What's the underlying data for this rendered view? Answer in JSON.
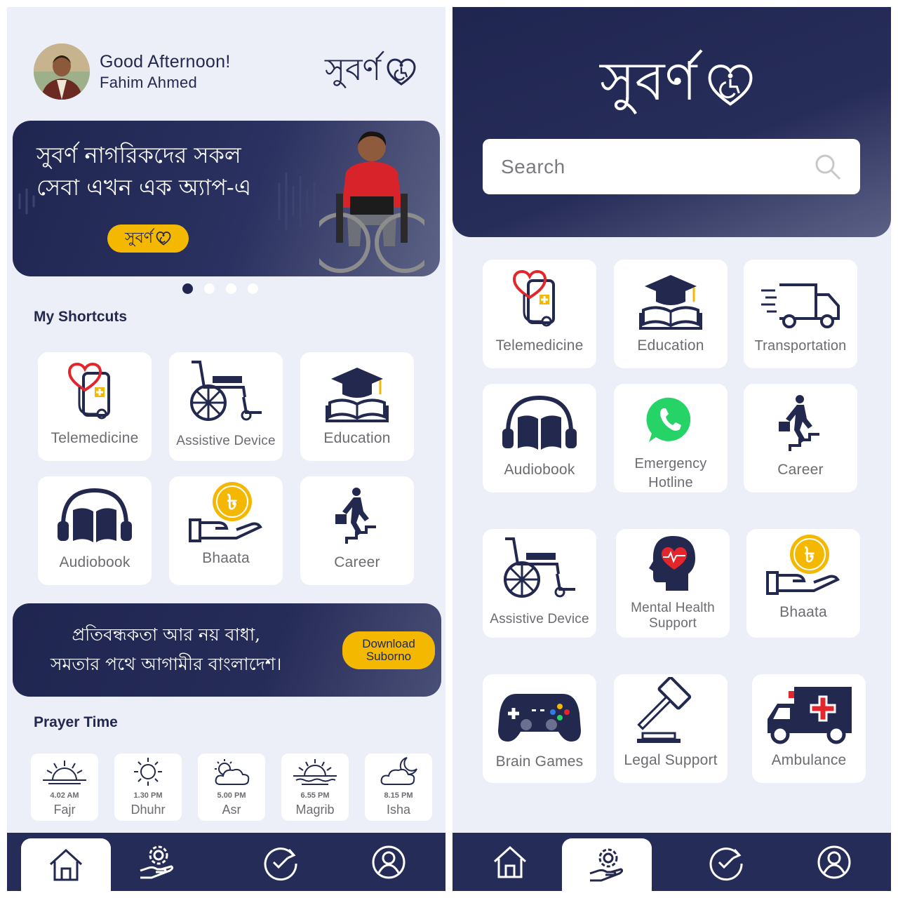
{
  "left": {
    "greeting": "Good Afternoon!",
    "user_name": "Fahim Ahmed",
    "logo_text": "সুবর্ণ",
    "banner": {
      "line1": "সুবর্ণ নাগরিকদের সকল",
      "line2": "সেবা এখন এক অ্যাপ-এ",
      "pill_text": "সুবর্ণ"
    },
    "carousel": {
      "count": 4,
      "active": 0
    },
    "shortcuts_title": "My Shortcuts",
    "shortcuts": [
      {
        "label": "Telemedicine",
        "icon": "telemedicine-icon"
      },
      {
        "label": "Assistive Device",
        "icon": "wheelchair-icon"
      },
      {
        "label": "Education",
        "icon": "education-icon"
      },
      {
        "label": "Audiobook",
        "icon": "audiobook-icon"
      },
      {
        "label": "Bhaata",
        "icon": "bhaata-icon"
      },
      {
        "label": "Career",
        "icon": "career-icon"
      }
    ],
    "promo": {
      "line1": "প্রতিবন্ধকতা আর নয় বাধা,",
      "line2": "সমতার পথে আগামীর বাংলাদেশ।",
      "button_line1": "Download",
      "button_line2": "Suborno"
    },
    "prayer_title": "Prayer Time",
    "prayers": [
      {
        "time": "4.02 AM",
        "name": "Fajr",
        "icon": "sunrise-icon"
      },
      {
        "time": "1.30 PM",
        "name": "Dhuhr",
        "icon": "sun-icon"
      },
      {
        "time": "5.00 PM",
        "name": "Asr",
        "icon": "sun-cloud-icon"
      },
      {
        "time": "6.55 PM",
        "name": "Magrib",
        "icon": "sunset-icon"
      },
      {
        "time": "8.15 PM",
        "name": "Isha",
        "icon": "moon-cloud-icon"
      }
    ],
    "nav": [
      {
        "icon": "home-icon",
        "active": true
      },
      {
        "icon": "services-icon",
        "active": false
      },
      {
        "icon": "history-icon",
        "active": false
      },
      {
        "icon": "profile-icon",
        "active": false
      }
    ]
  },
  "right": {
    "logo_text": "সুবর্ণ",
    "search_placeholder": "Search",
    "services": [
      {
        "label": "Telemedicine",
        "icon": "telemedicine-icon"
      },
      {
        "label": "Education",
        "icon": "education-icon"
      },
      {
        "label": "Transportation",
        "icon": "truck-icon"
      },
      {
        "label": "Audiobook",
        "icon": "audiobook-icon"
      },
      {
        "label": "Emergency Hotline",
        "icon": "phone-icon"
      },
      {
        "label": "Career",
        "icon": "career-icon"
      },
      {
        "label": "Assistive Device",
        "icon": "wheelchair-icon"
      },
      {
        "label": "Mental Health Support",
        "icon": "mental-health-icon"
      },
      {
        "label": "Bhaata",
        "icon": "bhaata-icon"
      },
      {
        "label": "Brain Games",
        "icon": "gamepad-icon"
      },
      {
        "label": "Legal Support",
        "icon": "gavel-icon"
      },
      {
        "label": "Ambulance",
        "icon": "ambulance-icon"
      }
    ],
    "nav": [
      {
        "icon": "home-icon",
        "active": false
      },
      {
        "icon": "services-icon",
        "active": true
      },
      {
        "icon": "history-icon",
        "active": false
      },
      {
        "icon": "profile-icon",
        "active": false
      }
    ]
  },
  "colors": {
    "navy": "#1f2650",
    "accent_yellow": "#f5b800",
    "background": "#eceef8",
    "tile": "#ffffff",
    "red": "#e2262b",
    "green": "#25d366"
  }
}
